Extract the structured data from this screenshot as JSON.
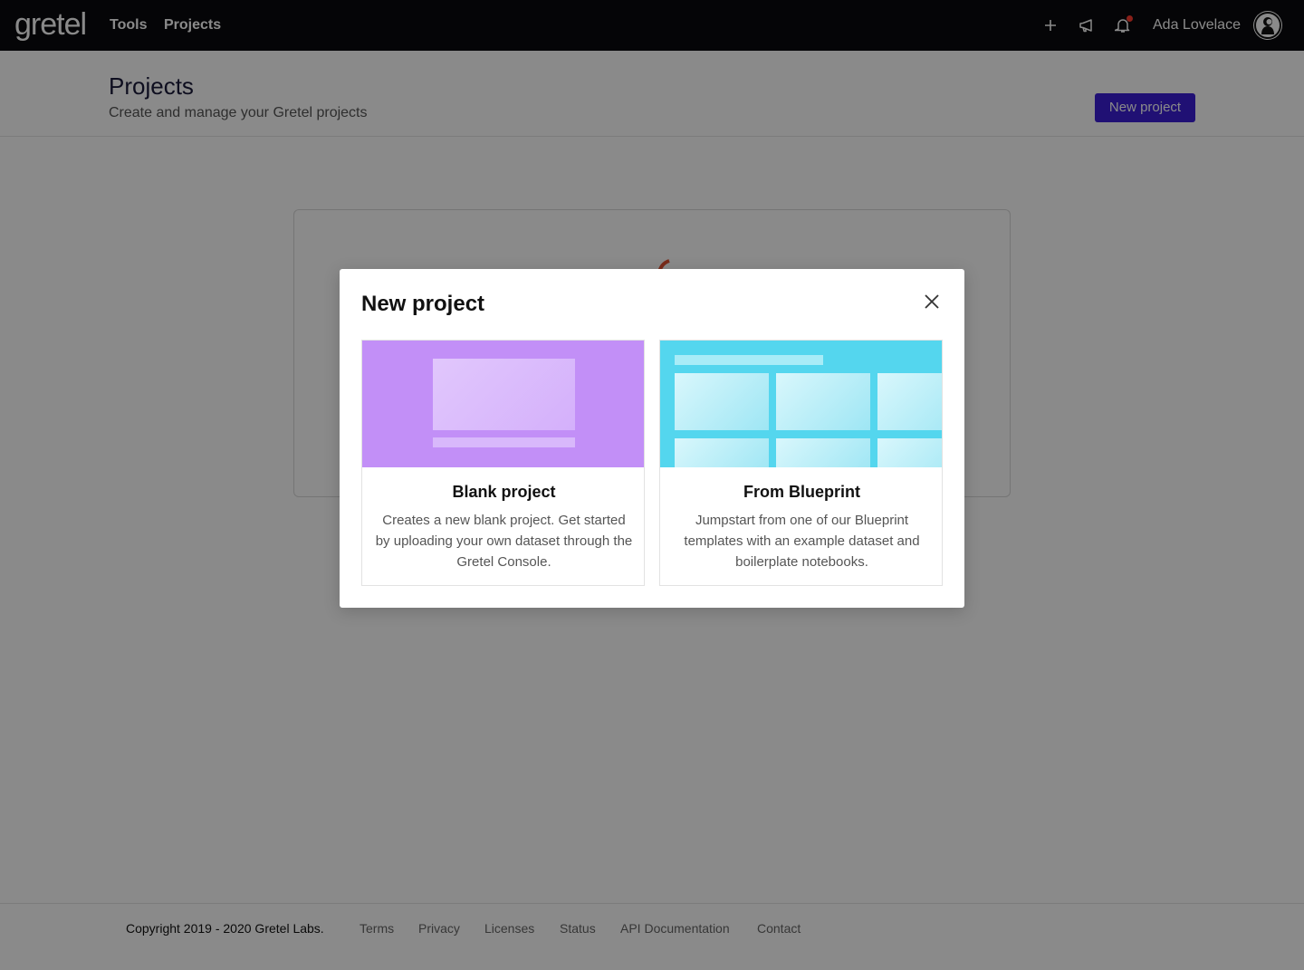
{
  "nav": {
    "logo": "gretel",
    "links": [
      "Tools",
      "Projects"
    ],
    "icons": [
      "plus-icon",
      "megaphone-icon",
      "bell-icon"
    ],
    "username": "Ada Lovelace",
    "notification_dot_color": "#ff3b2f"
  },
  "header": {
    "title": "Projects",
    "subtitle": "Create and manage your Gretel projects",
    "new_project_label": "New project",
    "button_color": "#3b1fd6"
  },
  "modal": {
    "title": "New project",
    "options": [
      {
        "title": "Blank project",
        "description": "Creates a new blank project. Get started by uploading your own dataset through the Gretel Console.",
        "thumb_color": "#c28ff7"
      },
      {
        "title": "From Blueprint",
        "description": "Jumpstart from one of our Blueprint templates with an example dataset and boilerplate notebooks.",
        "thumb_color": "#54d6ee"
      }
    ]
  },
  "footer": {
    "copyright": "Copyright 2019 - 2020 Gretel Labs.",
    "links": [
      "Terms",
      "Privacy",
      "Licenses",
      "Status",
      "API Documentation",
      "Contact"
    ]
  }
}
